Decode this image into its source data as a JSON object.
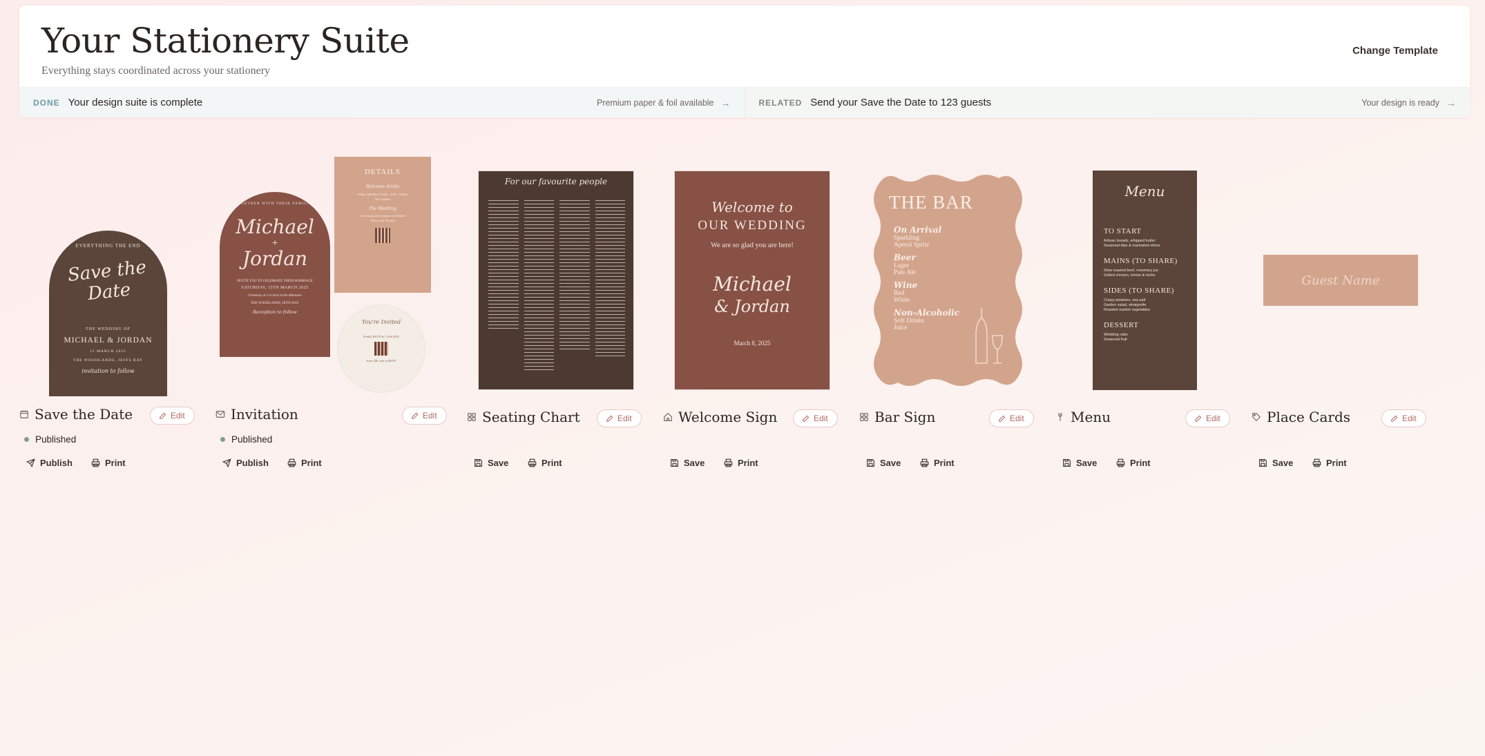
{
  "header": {
    "title": "Your Stationery Suite",
    "subtitle": "Everything stays coordinated across your stationery",
    "change_template": "Change Template"
  },
  "status": {
    "done": {
      "label": "DONE",
      "message": "Your design suite is complete",
      "link": "Premium paper & foil available"
    },
    "related": {
      "label": "RELATED",
      "message": "Send your Save the Date to 123 guests",
      "link": "Your design is ready"
    }
  },
  "colors": {
    "dark_brown": "#5b4439",
    "terracotta": "#875146",
    "blush": "#d3a48c",
    "published_dot": "#7fa07e",
    "edit_accent": "#b06a62"
  },
  "cards": [
    {
      "title": "Save the Date",
      "icon": "calendar-icon",
      "edit": "Edit",
      "status": "Published",
      "actions": [
        "Publish",
        "Print"
      ]
    },
    {
      "title": "Invitation",
      "icon": "envelope-icon",
      "edit": "Edit",
      "status": "Published",
      "actions": [
        "Publish",
        "Print"
      ]
    },
    {
      "title": "Seating Chart",
      "icon": "grid-icon",
      "edit": "Edit",
      "actions": [
        "Save",
        "Print"
      ]
    },
    {
      "title": "Welcome Sign",
      "icon": "home-icon",
      "edit": "Edit",
      "actions": [
        "Save",
        "Print"
      ]
    },
    {
      "title": "Bar Sign",
      "icon": "grid-icon",
      "edit": "Edit",
      "actions": [
        "Save",
        "Print"
      ]
    },
    {
      "title": "Menu",
      "icon": "utensils-icon",
      "edit": "Edit",
      "actions": [
        "Save",
        "Print"
      ]
    },
    {
      "title": "Place Cards",
      "icon": "tag-icon",
      "edit": "Edit",
      "actions": [
        "Save",
        "Print"
      ]
    }
  ],
  "previews": {
    "save_the_date": {
      "top": "EVERYTHING THE END",
      "script": "Save the Date",
      "pre": "THE WEDDING OF",
      "names": "MICHAEL & JORDAN",
      "date": "15 MARCH 2025",
      "venue": "THE WOODLANDS, JEFFS BAY",
      "footer": "invitation to follow"
    },
    "invitation": {
      "top": "TOGETHER WITH THEIR FAMILIES",
      "name1": "Michael",
      "amp": "+",
      "name2": "Jordan",
      "line1": "INVITE YOU TO CELEBRATE THEIR MARRIAGE",
      "line2": "SATURDAY, 15TH MARCH 2025",
      "line3": "Ceremony at 3 o'clock in the afternoon",
      "line4": "THE WOODLANDS, JEFFS BAY",
      "footer": "Reception to follow"
    },
    "details": {
      "title": "DETAILS",
      "h1": "Welcome drinks",
      "t1": "Friday 14th March 2025 · 4:00 - 7:00pm",
      "t2": "The Gardens",
      "h2": "The Wedding",
      "t3": "Ceremony and reception as detailed",
      "t4": "Dress code: Formal"
    },
    "rsvp": {
      "title": "You're Invited",
      "t1": "Kindly RSVP by 1 Feb 2025",
      "t2": "Scan QR code to RSVP"
    },
    "seating": {
      "title": "For our favourite people"
    },
    "welcome": {
      "script1": "Welcome to",
      "caps": "OUR WEDDING",
      "sub": "We are so glad you are here!",
      "name1": "Michael",
      "name2": "& Jordan",
      "date": "March 8, 2025"
    },
    "bar": {
      "title": "THE BAR",
      "sections": [
        {
          "head": "On Arrival",
          "items": [
            "Sparkling",
            "Aperol Spritz"
          ]
        },
        {
          "head": "Beer",
          "items": [
            "Lager",
            "Pale Ale"
          ]
        },
        {
          "head": "Wine",
          "items": [
            "Red",
            "White"
          ]
        },
        {
          "head": "Non-Alcoholic",
          "items": [
            "Soft Drinks",
            "Juice"
          ]
        }
      ]
    },
    "menu": {
      "title": "Menu",
      "sections": [
        {
          "head": "TO START",
          "items": [
            "Artisan breads, whipped butter",
            "Seasonal dips & marinated olives"
          ]
        },
        {
          "head": "MAINS (TO SHARE)",
          "items": [
            "Slow roasted beef, rosemary jus",
            "Grilled chicken, lemon & herbs"
          ]
        },
        {
          "head": "SIDES (TO SHARE)",
          "items": [
            "Crispy potatoes, sea salt",
            "Garden salad, vinaigrette",
            "Roasted market vegetables"
          ]
        },
        {
          "head": "DESSERT",
          "items": [
            "Wedding cake",
            "Seasonal fruit"
          ]
        }
      ]
    },
    "place_card": {
      "script": "Guest Name"
    }
  }
}
